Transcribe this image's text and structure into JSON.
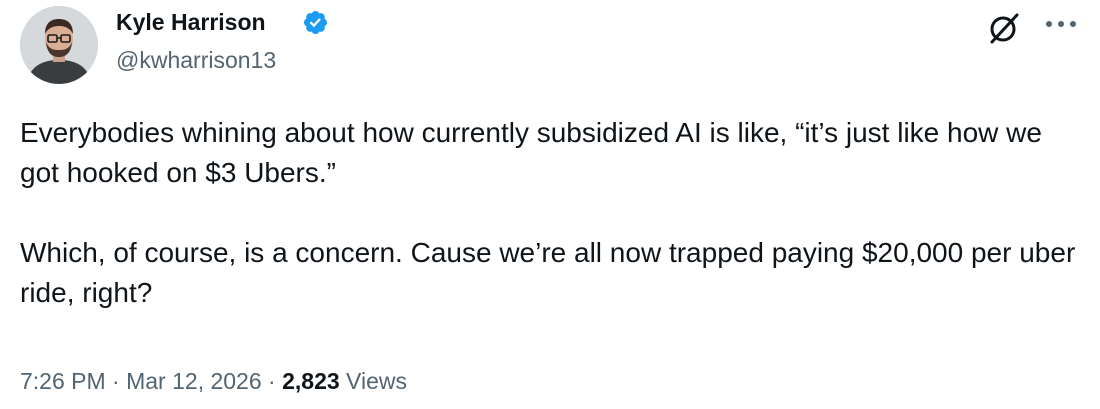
{
  "author": {
    "display_name": "Kyle Harrison",
    "handle": "@kwharrison13",
    "verified": true,
    "avatar_icon": "profile-photo-man-glasses"
  },
  "tweet": {
    "paragraphs": [
      "Everybodies whining about how currently subsidized AI is like, “it’s just like how we got hooked on $3 Ubers.”",
      "Which, of course, is a concern. Cause we’re all now trapped paying $20,000 per uber ride, right?"
    ]
  },
  "meta": {
    "time": "7:26 PM",
    "separator_1": " · ",
    "date": "Mar 12, 2026",
    "separator_2": " · ",
    "views_count": "2,823",
    "views_label": " Views"
  },
  "icons": {
    "verified": "verified-badge-icon",
    "grok": "grok-icon",
    "more": "more-options-icon"
  },
  "colors": {
    "text_primary": "#0f1419",
    "text_secondary": "#536471",
    "verified_blue": "#1d9bf0",
    "background": "#ffffff"
  }
}
